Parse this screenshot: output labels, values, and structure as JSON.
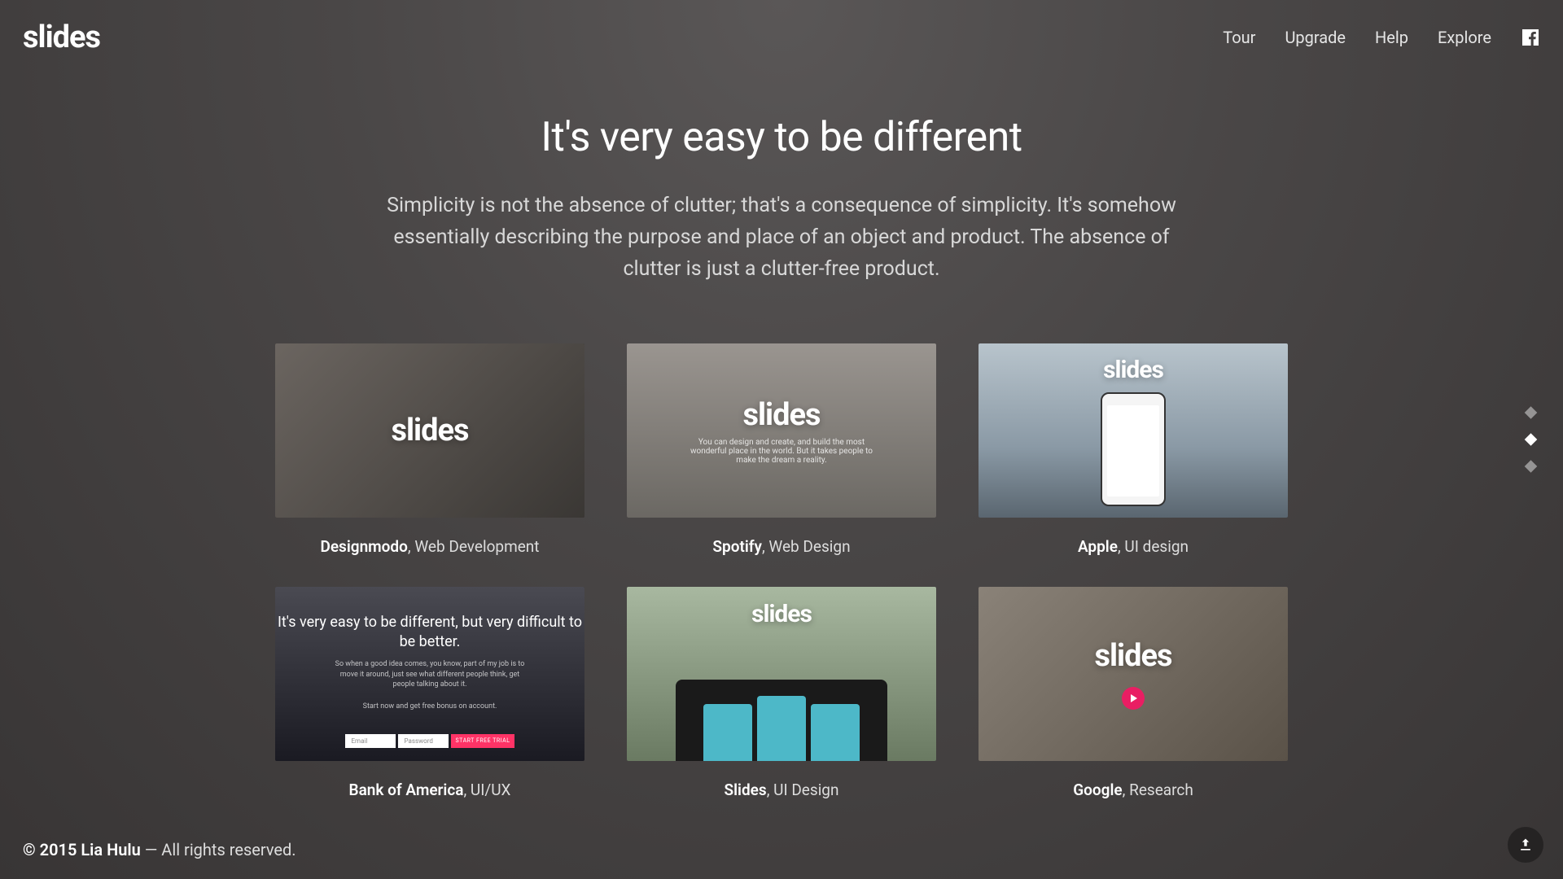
{
  "logo": "slides",
  "nav": {
    "items": [
      "Tour",
      "Upgrade",
      "Help",
      "Explore"
    ]
  },
  "hero": {
    "title": "It's very easy to be different",
    "subtitle": "Simplicity is not the absence of clutter; that's a consequence of simplicity. It's somehow essentially describing the purpose and place of an object and product. The absence of clutter is just a clutter-free product."
  },
  "cards": [
    {
      "thumb_logo": "slides",
      "title": "Designmodo",
      "category": ", Web Development"
    },
    {
      "thumb_logo": "slides",
      "tagline": "You can design and create, and build the most wonderful place in the world. But it takes people to make the dream a reality.",
      "title": "Spotify",
      "category": ", Web Design"
    },
    {
      "thumb_logo": "slides",
      "title": "Apple",
      "category": ", UI design"
    },
    {
      "thumb_title": "It's very easy to be different, but very difficult to be better.",
      "thumb_sub": "So when a good idea comes, you know, part of my job is to move it around, just see what different people think, get people talking about it.",
      "thumb_bonus": "Start now and get free bonus on account.",
      "email_ph": "Email",
      "pw_ph": "Password",
      "btn": "START FREE TRIAL",
      "title": "Bank of America",
      "category": ", UI/UX"
    },
    {
      "thumb_logo": "slides",
      "title": "Slides",
      "category": ", UI Design"
    },
    {
      "thumb_logo": "slides",
      "title": "Google",
      "category": ", Research"
    }
  ],
  "footer": {
    "copyright_bold": "© 2015 Lia Hulu",
    "copyright_rest": " — All rights reserved."
  },
  "pagination": {
    "active_index": 1,
    "count": 3
  }
}
